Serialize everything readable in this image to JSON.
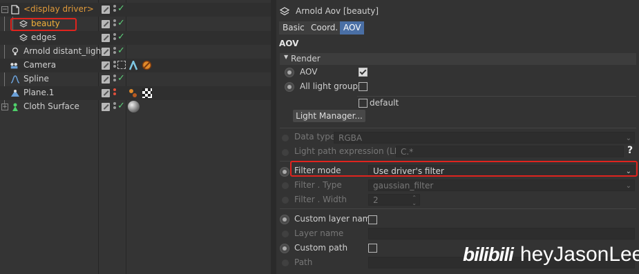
{
  "outliner": {
    "items": [
      {
        "name": "<display driver>",
        "icon": "document-icon",
        "highlight": true
      },
      {
        "name": "beauty",
        "icon": "aov-layer-icon",
        "selected": true
      },
      {
        "name": "edges",
        "icon": "aov-layer-icon"
      },
      {
        "name": "Arnold distant_light",
        "icon": "light-bulb-icon"
      },
      {
        "name": "Camera",
        "icon": "camera-icon"
      },
      {
        "name": "Spline",
        "icon": "spline-icon"
      },
      {
        "name": "Plane.1",
        "icon": "plane-icon"
      },
      {
        "name": "Cloth Surface",
        "icon": "cloth-surface-icon"
      }
    ]
  },
  "attributes": {
    "title": "Arnold Aov [beauty]",
    "tabs": [
      "Basic",
      "Coord.",
      "AOV"
    ],
    "active_tab": "AOV",
    "section": "AOV",
    "group": "Render",
    "aov_label": "AOV",
    "aov_checked": true,
    "all_light_groups_label": "All light groups",
    "all_light_groups_checked": false,
    "default_label": "default",
    "default_checked": false,
    "light_manager_button": "Light Manager...",
    "data_type_label": "Data type",
    "data_type_value": "RGBA",
    "lpe_label": "Light path expression (LPE)",
    "lpe_value": "C.*",
    "help_glyph": "?",
    "filter_mode_label": "Filter mode",
    "filter_mode_value": "Use driver's filter",
    "filter_type_label": "Filter . Type",
    "filter_type_value": "gaussian_filter",
    "filter_width_label": "Filter . Width",
    "filter_width_value": "2",
    "custom_layer_name_label": "Custom layer name",
    "custom_layer_name_checked": false,
    "layer_name_label": "Layer name",
    "custom_path_label": "Custom path",
    "custom_path_checked": false,
    "path_label": "Path"
  },
  "watermark": {
    "logo": "bilibili",
    "user": "heyJasonLee"
  },
  "colors": {
    "highlight_box": "#e0241e",
    "active_tab": "#4a6fa5",
    "display_driver_text": "#e09a3a",
    "check": "#5ed07a"
  }
}
